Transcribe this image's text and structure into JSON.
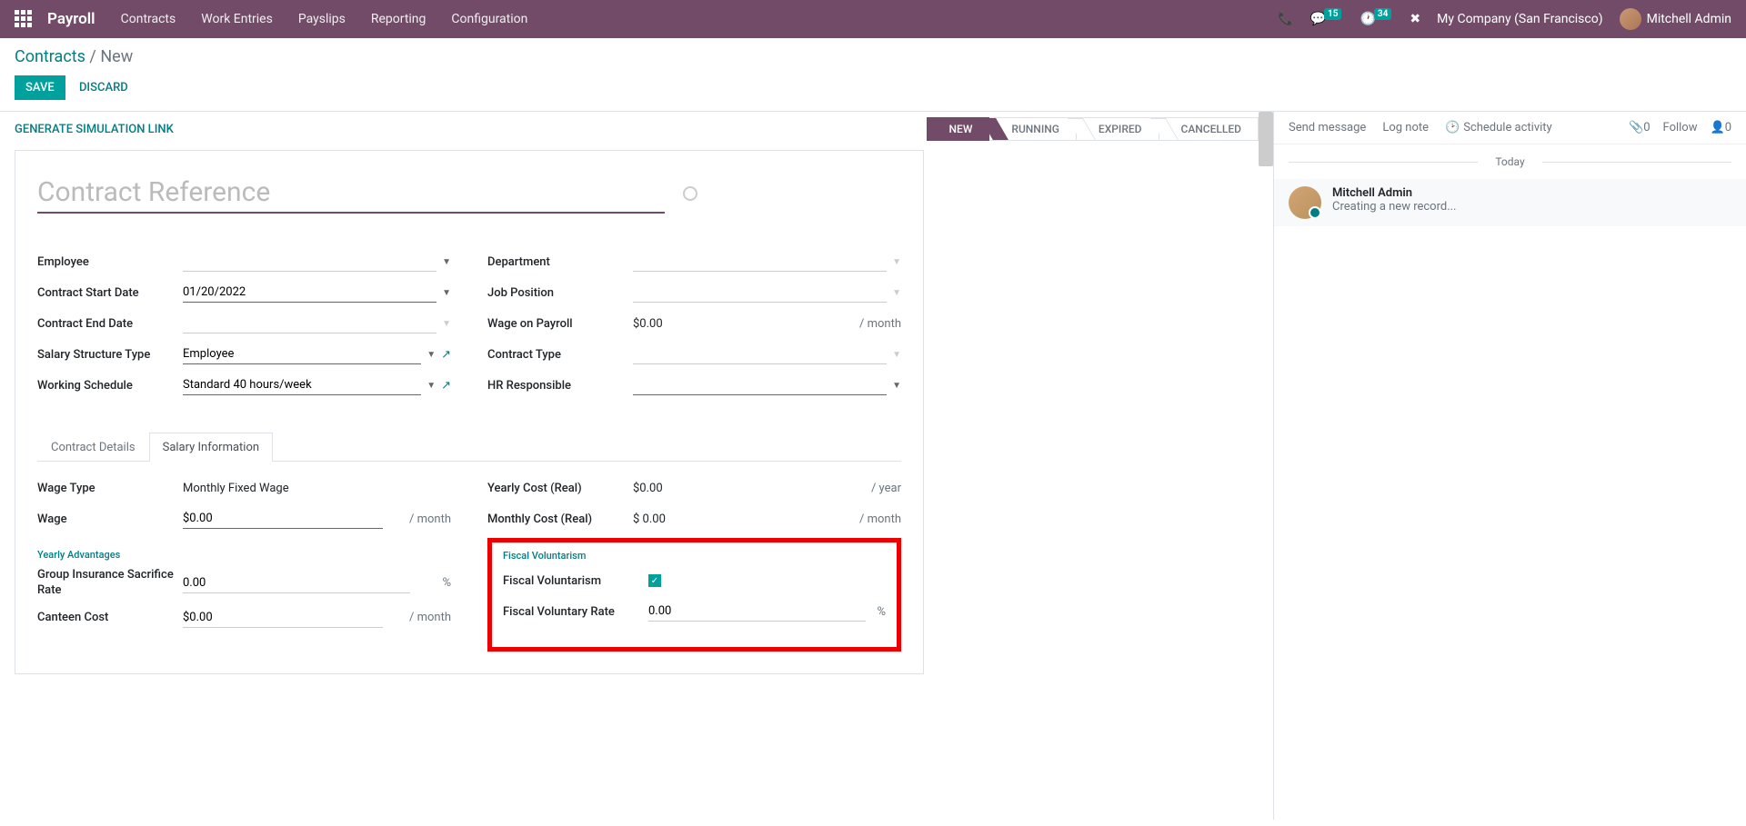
{
  "navbar": {
    "app": "Payroll",
    "menu": [
      "Contracts",
      "Work Entries",
      "Payslips",
      "Reporting",
      "Configuration"
    ],
    "msg_badge": "15",
    "activity_badge": "34",
    "company": "My Company (San Francisco)",
    "user": "Mitchell Admin"
  },
  "breadcrumb": {
    "parent": "Contracts",
    "current": "New"
  },
  "buttons": {
    "save": "Save",
    "discard": "Discard",
    "gensim": "Generate Simulation Link"
  },
  "stages": [
    "New",
    "Running",
    "Expired",
    "Cancelled"
  ],
  "title_placeholder": "Contract Reference",
  "fields": {
    "left": [
      {
        "label": "Employee",
        "value": "",
        "type": "dropdown"
      },
      {
        "label": "Contract Start Date",
        "value": "01/20/2022",
        "type": "date"
      },
      {
        "label": "Contract End Date",
        "value": "",
        "type": "date-light"
      },
      {
        "label": "Salary Structure Type",
        "value": "Employee",
        "type": "dropdown-ext"
      },
      {
        "label": "Working Schedule",
        "value": "Standard 40 hours/week",
        "type": "dropdown-ext"
      }
    ],
    "right": [
      {
        "label": "Department",
        "value": "",
        "type": "dropdown-light"
      },
      {
        "label": "Job Position",
        "value": "",
        "type": "dropdown-light"
      },
      {
        "label": "Wage on Payroll",
        "value": "$0.00",
        "suffix": "/ month",
        "type": "text"
      },
      {
        "label": "Contract Type",
        "value": "",
        "type": "dropdown-light"
      },
      {
        "label": "HR Responsible",
        "value": "",
        "type": "dropdown"
      }
    ]
  },
  "tabs": [
    "Contract Details",
    "Salary Information"
  ],
  "salary": {
    "left": [
      {
        "label": "Wage Type",
        "value": "Monthly Fixed Wage",
        "type": "static"
      },
      {
        "label": "Wage",
        "value": "$0.00",
        "suffix": "/ month",
        "type": "input"
      }
    ],
    "right": [
      {
        "label": "Yearly Cost (Real)",
        "value": "$0.00",
        "suffix": "/ year",
        "type": "text"
      },
      {
        "label": "Monthly Cost (Real)",
        "value": "$ 0.00",
        "suffix": "/ month",
        "type": "text"
      }
    ],
    "yearly_adv_header": "Yearly Advantages",
    "yearly_adv": [
      {
        "label": "Group Insurance Sacrifice Rate",
        "value": "0.00",
        "suffix": "%"
      },
      {
        "label": "Canteen Cost",
        "value": "$0.00",
        "suffix": "/ month"
      }
    ],
    "fiscal_header": "Fiscal Voluntarism",
    "fiscal": [
      {
        "label": "Fiscal Voluntarism",
        "type": "checkbox"
      },
      {
        "label": "Fiscal Voluntary Rate",
        "value": "0.00",
        "suffix": "%"
      }
    ]
  },
  "chatter": {
    "send": "Send message",
    "log": "Log note",
    "schedule": "Schedule activity",
    "follow": "Follow",
    "attach_count": "0",
    "follower_count": "0",
    "today": "Today",
    "msg_author": "Mitchell Admin",
    "msg_text": "Creating a new record..."
  }
}
